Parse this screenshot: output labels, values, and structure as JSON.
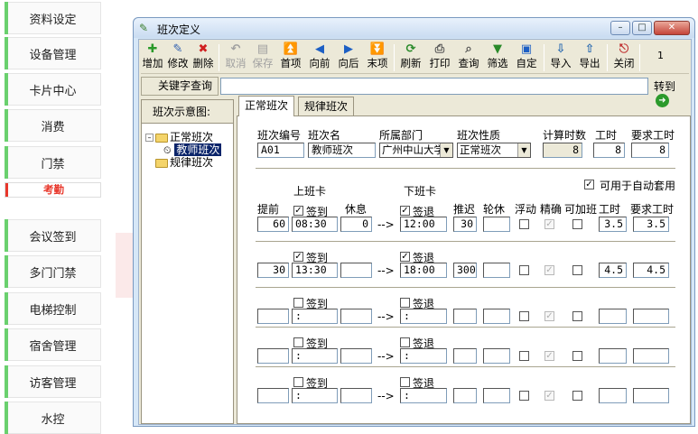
{
  "nav": {
    "items": [
      "资料设定",
      "设备管理",
      "卡片中心",
      "消费",
      "门禁",
      "考勤",
      "会议签到",
      "多门门禁",
      "电梯控制",
      "宿舍管理",
      "访客管理",
      "水控"
    ],
    "selected": "考勤"
  },
  "window": {
    "title": "班次定义",
    "controls": [
      "minimize",
      "maximize",
      "close"
    ]
  },
  "toolbar": {
    "add": "增加",
    "edit": "修改",
    "delete": "删除",
    "cancel": "取消",
    "save": "保存",
    "first": "首项",
    "prev": "向前",
    "next": "向后",
    "last": "末项",
    "refresh": "刷新",
    "print": "打印",
    "query": "查询",
    "filter": "筛选",
    "custom": "自定",
    "import": "导入",
    "export": "导出",
    "close": "关闭",
    "page": "1"
  },
  "search": {
    "label": "关键字查询",
    "value": "",
    "goto": "转到"
  },
  "tree": {
    "header": "班次示意图:",
    "root1": "正常班次",
    "child": "教师班次",
    "root2": "规律班次"
  },
  "tabs": {
    "normal": "正常班次",
    "regular": "规律班次"
  },
  "form": {
    "code_label": "班次编号",
    "code": "A01",
    "name_label": "班次名",
    "name": "教师班次",
    "dept_label": "所属部门",
    "dept": "广州中山大学",
    "type_label": "班次性质",
    "type": "正常班次",
    "calc_hours_label": "计算时数",
    "calc_hours": "8",
    "hours_label": "工时",
    "hours": "8",
    "req_hours_label": "要求工时",
    "req_hours": "8",
    "auto_label": "可用于自动套用",
    "auto_checked": true
  },
  "grid": {
    "h_on_card": "上班卡",
    "h_off_card": "下班卡",
    "h_early": "提前",
    "h_rest": "休息",
    "h_delay": "推迟",
    "h_off": "轮休",
    "h_float": "浮动",
    "h_exact": "精确",
    "h_overtime": "可加班",
    "h_hours": "工时",
    "h_req": "要求工时",
    "checkin": "签到",
    "checkout": "签退",
    "arrow": "-->",
    "rows": [
      {
        "early": "60",
        "on": "08:30",
        "on_checked": true,
        "rest": "0",
        "off": "12:00",
        "off_checked": true,
        "delay": "30",
        "hours": "3.5",
        "req": "3.5"
      },
      {
        "early": "30",
        "on": "13:30",
        "on_checked": true,
        "rest": "",
        "off": "18:00",
        "off_checked": true,
        "delay": "300",
        "hours": "4.5",
        "req": "4.5"
      },
      {
        "early": "",
        "on": " :",
        "on_checked": false,
        "rest": "",
        "off": " :",
        "off_checked": false,
        "delay": "",
        "hours": "",
        "req": ""
      },
      {
        "early": "",
        "on": " :",
        "on_checked": false,
        "rest": "",
        "off": " :",
        "off_checked": false,
        "delay": "",
        "hours": "",
        "req": ""
      },
      {
        "early": "",
        "on": " :",
        "on_checked": false,
        "rest": "",
        "off": " :",
        "off_checked": false,
        "delay": "",
        "hours": "",
        "req": ""
      }
    ]
  }
}
